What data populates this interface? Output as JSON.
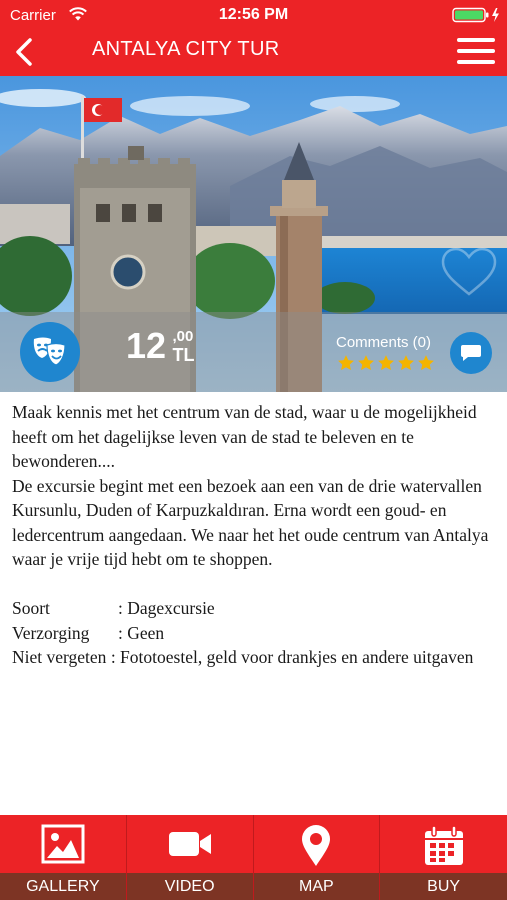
{
  "status_bar": {
    "carrier": "Carrier",
    "time": "12:56 PM"
  },
  "nav": {
    "title": "ANTALYA CITY TUR"
  },
  "tour": {
    "price_main": "12",
    "price_cents": ",00",
    "price_currency": "TL",
    "comments_label": "Comments (0)",
    "rating": 5
  },
  "description": {
    "paragraph1": "Maak kennis met het centrum  van de stad, waar u de mogelijkheid heeft om het dagelijkse leven van de stad te beleven en te bewonderen....",
    "paragraph2": "De excursie begint met een bezoek aan een van de drie watervallen Kursunlu, Duden of Karpuzkaldıran. Erna wordt een goud- en ledercentrum aangedaan. We naar het het oude centrum van Antalya waar je vrije tijd hebt om te shoppen."
  },
  "details": [
    {
      "key": "Soort",
      "value": ": Dagexcursie"
    },
    {
      "key": "Verzorging",
      "value": ": Geen"
    },
    {
      "key": "Niet vergeten",
      "value": ": Fototoestel, geld voor drankjes en andere uitgaven"
    }
  ],
  "tabs": [
    {
      "label": "GALLERY",
      "icon": "picture-icon"
    },
    {
      "label": "VIDEO",
      "icon": "video-camera-icon"
    },
    {
      "label": "MAP",
      "icon": "map-pin-icon"
    },
    {
      "label": "BUY",
      "icon": "calendar-icon"
    }
  ],
  "colors": {
    "brand_red": "#ec2326",
    "tab_label_bg": "#7d3424",
    "accent_blue": "#1f86cf",
    "star": "#f4b400"
  }
}
